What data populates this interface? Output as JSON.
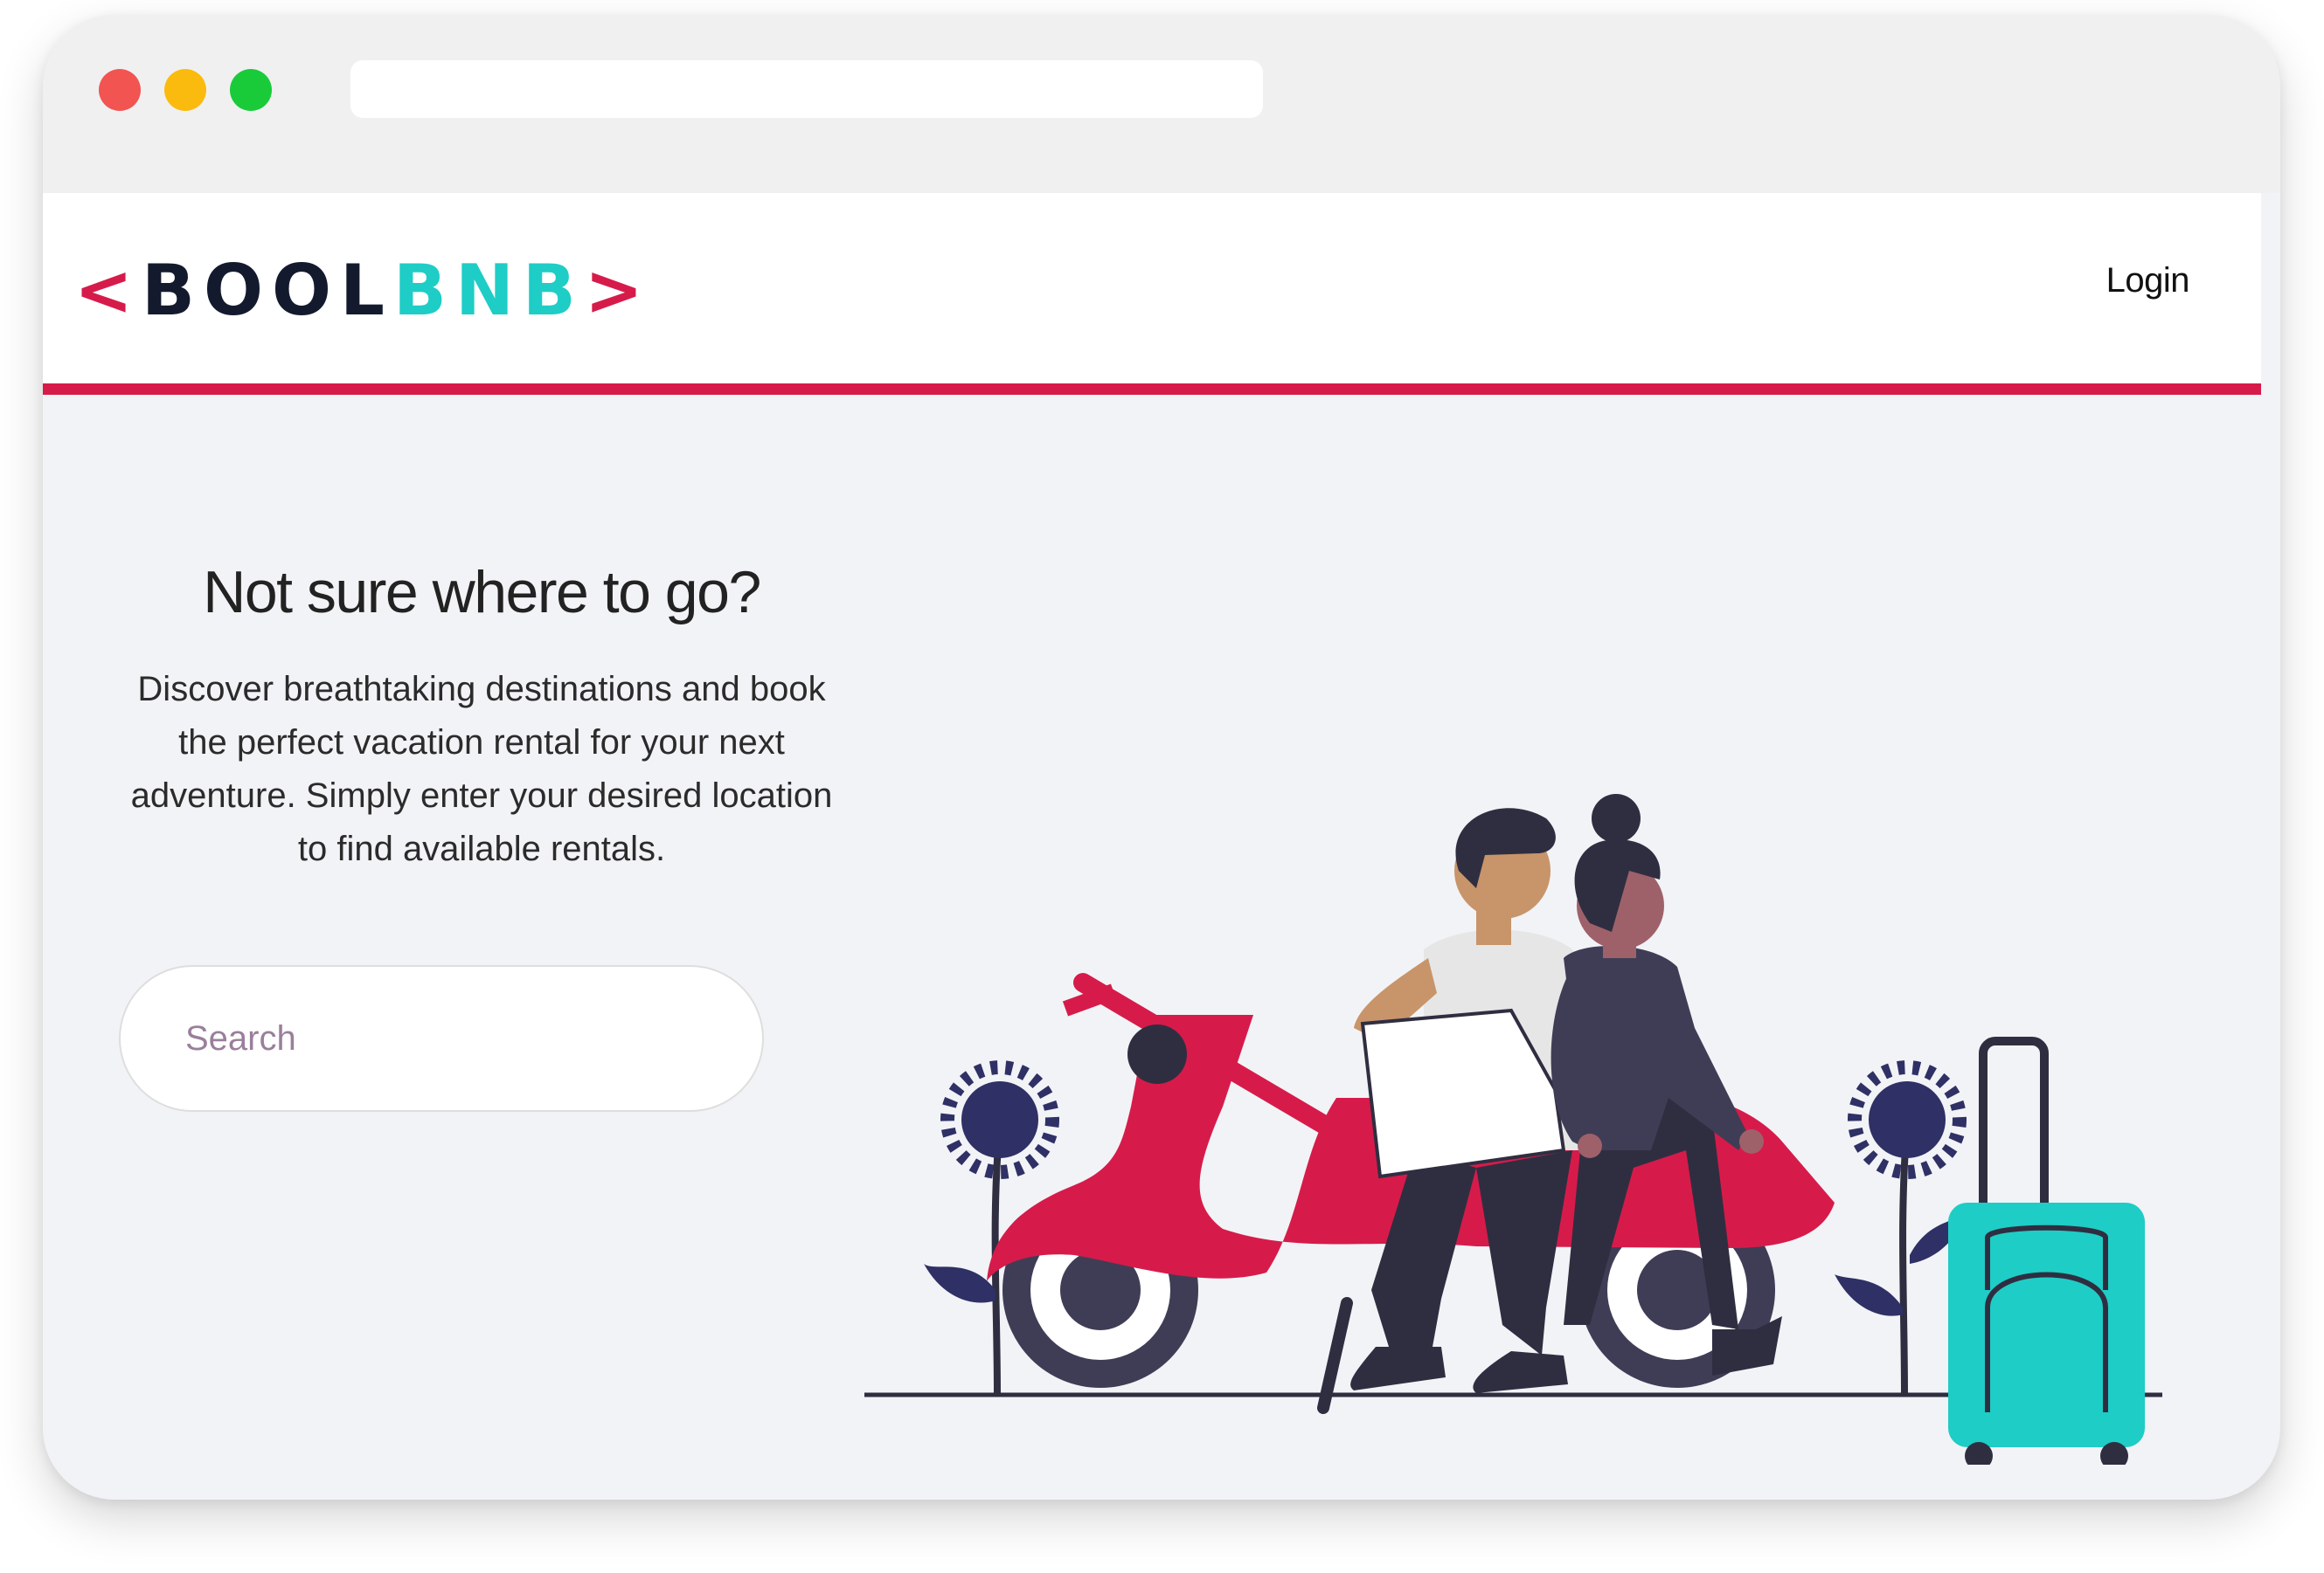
{
  "browser": {
    "controls": [
      "close-dot",
      "minimize-dot",
      "maximize-dot"
    ],
    "url": ""
  },
  "navbar": {
    "logo": {
      "open_bracket": "<",
      "part1": "BOOL",
      "part2": "BNB",
      "close_bracket": ">"
    },
    "login_label": "Login"
  },
  "hero": {
    "title": "Not sure where to go?",
    "description": "Discover breathtaking destinations and book the perfect vacation rental for your next adventure. Simply enter your desired location to find available rentals.",
    "search": {
      "placeholder": "Search",
      "value": ""
    },
    "illustration": "travel-couple-scooter-illustration"
  },
  "colors": {
    "accent": "#d61b4a",
    "brand_dark": "#141a2e",
    "brand_teal": "#1ecdc6",
    "page_bg": "#f2f3f6"
  }
}
